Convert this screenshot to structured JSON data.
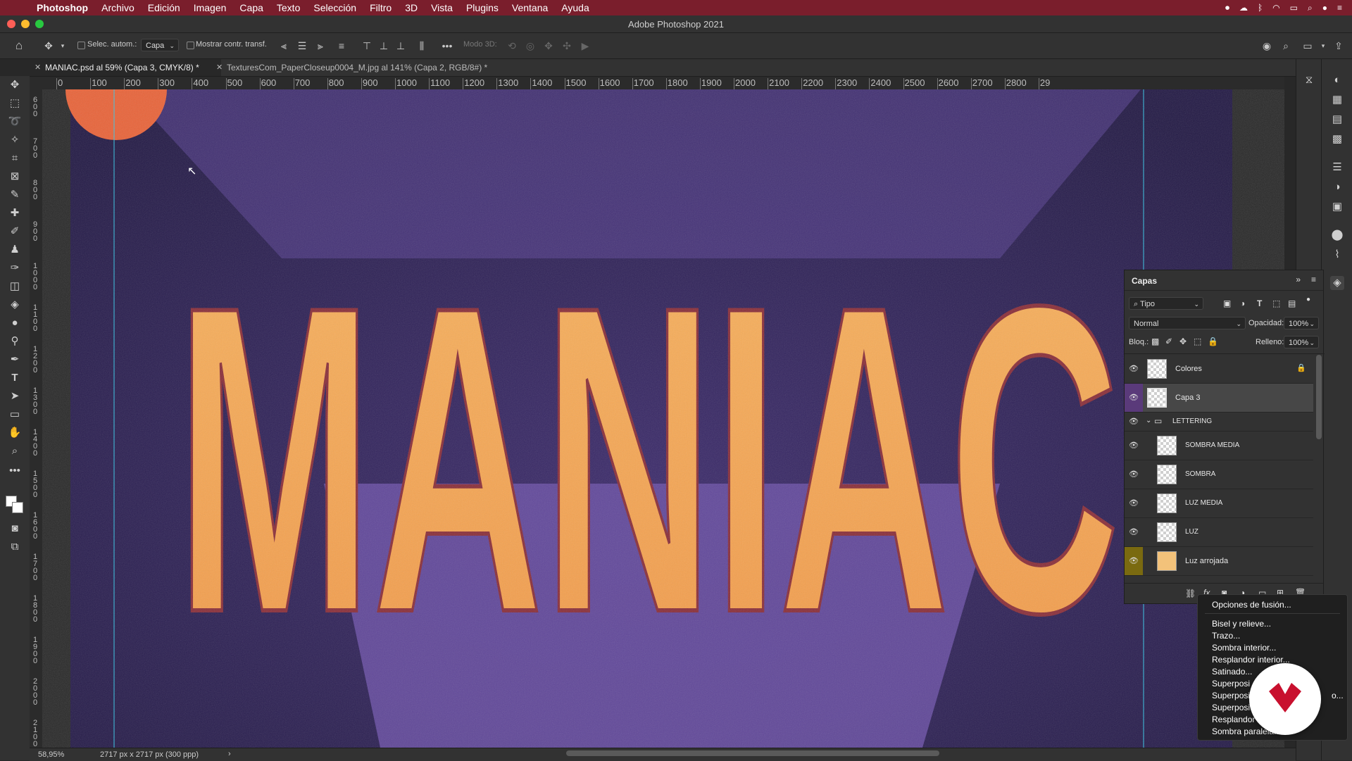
{
  "menubar": {
    "items": [
      "Photoshop",
      "Archivo",
      "Edición",
      "Imagen",
      "Capa",
      "Texto",
      "Selección",
      "Filtro",
      "3D",
      "Vista",
      "Plugins",
      "Ventana",
      "Ayuda"
    ]
  },
  "titlebar": {
    "title": "Adobe Photoshop 2021"
  },
  "options": {
    "auto_select_label": "Selec. autom.:",
    "auto_select_value": "Capa",
    "show_transform_label": "Mostrar contr. transf.",
    "mode3d_label": "Modo 3D:"
  },
  "tabs": [
    {
      "label": "MANIAC.psd al 59% (Capa 3, CMYK/8) *"
    },
    {
      "label": "TexturesCom_PaperCloseup0004_M.jpg al 141% (Capa 2, RGB/8#) *"
    }
  ],
  "ruler_top": [
    "0",
    "100",
    "200",
    "300",
    "400",
    "500",
    "600",
    "700",
    "800",
    "900",
    "1000",
    "1100",
    "1200",
    "1300",
    "1400",
    "1500",
    "1600",
    "1700",
    "1800",
    "1900",
    "2000",
    "2100",
    "2200",
    "2300",
    "2400",
    "2500",
    "2600",
    "2700",
    "2800",
    "29"
  ],
  "ruler_left": [
    "600",
    "700",
    "800",
    "900",
    "1000",
    "1100",
    "1200",
    "1300",
    "1400",
    "1500",
    "1600",
    "1700",
    "1800",
    "1900",
    "2000",
    "2100"
  ],
  "canvas": {
    "lettering": "MANIAC"
  },
  "layers_panel": {
    "title": "Capas",
    "filter_value": "Tipo",
    "blend_mode": "Normal",
    "opacity_label": "Opacidad:",
    "opacity_value": "100%",
    "lock_label": "Bloq.:",
    "fill_label": "Relleno:",
    "fill_value": "100%",
    "layers": [
      {
        "name": "Colores",
        "locked": true
      },
      {
        "name": "Capa 3",
        "selected": true
      },
      {
        "name": "LETTERING",
        "group": true
      },
      {
        "name": "SOMBRA MEDIA"
      },
      {
        "name": "SOMBRA"
      },
      {
        "name": "LUZ MEDIA"
      },
      {
        "name": "LUZ"
      },
      {
        "name": "Luz arrojada"
      }
    ]
  },
  "context_menu": {
    "items": [
      "Opciones de fusión...",
      "Bisel y relieve...",
      "Trazo...",
      "Sombra interior...",
      "Resplandor interior...",
      "Satinado...",
      "Superposi",
      "Superposi",
      "Superposi",
      "Resplandor",
      "Sombra paralela..."
    ],
    "overflow_fragment": "o..."
  },
  "status": {
    "zoom": "58,95%",
    "doc_info": "2717 px x 2717 px (300 ppp)"
  },
  "colors": {
    "menubar": "#7a1e2c",
    "accent_selected_eye": "#5a3a7a",
    "group_eye": "#7a6a10",
    "badge": "#c8102e"
  }
}
